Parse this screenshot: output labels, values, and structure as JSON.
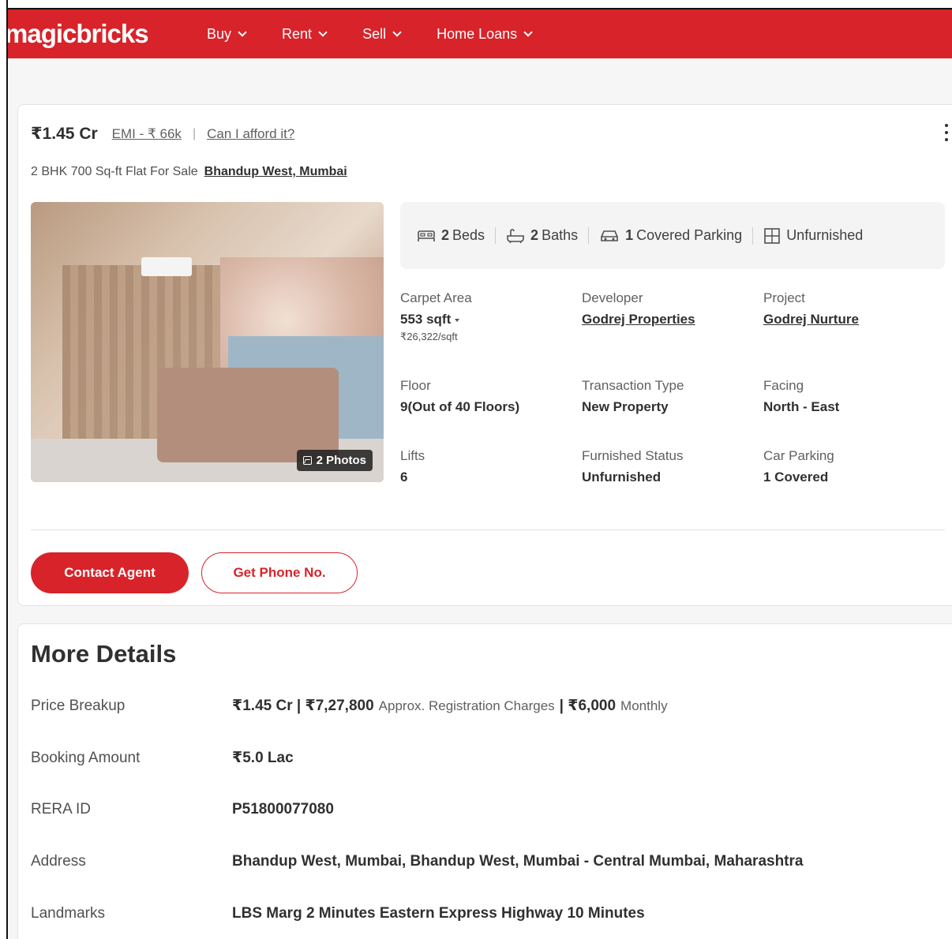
{
  "header": {
    "logo": "magicbricks",
    "nav": [
      {
        "label": "Buy"
      },
      {
        "label": "Rent"
      },
      {
        "label": "Sell"
      },
      {
        "label": "Home Loans"
      }
    ]
  },
  "listing": {
    "price": "₹1.45 Cr",
    "emi": "EMI - ₹ 66k",
    "separator": "|",
    "afford": "Can I afford it?",
    "title": "2 BHK 700 Sq-ft Flat For Sale",
    "location": "Bhandup West, Mumbai",
    "photos_label": "2 Photos",
    "amenities": [
      {
        "icon": "bed-icon",
        "value": "2",
        "label": "Beds"
      },
      {
        "icon": "bath-icon",
        "value": "2",
        "label": "Baths"
      },
      {
        "icon": "car-icon",
        "value": "1",
        "label": "Covered Parking"
      },
      {
        "icon": "furnishing-icon",
        "value": "",
        "label": "Unfurnished"
      }
    ],
    "details": {
      "carpet_area_label": "Carpet Area",
      "carpet_area_value": "553 sqft",
      "carpet_area_rate": "₹26,322/sqft",
      "developer_label": "Developer",
      "developer_value": "Godrej Properties",
      "project_label": "Project",
      "project_value": "Godrej Nurture",
      "floor_label": "Floor",
      "floor_value": "9(Out of 40 Floors)",
      "transaction_label": "Transaction Type",
      "transaction_value": "New Property",
      "facing_label": "Facing",
      "facing_value": "North - East",
      "lifts_label": "Lifts",
      "lifts_value": "6",
      "furnished_label": "Furnished Status",
      "furnished_value": "Unfurnished",
      "parking_label": "Car Parking",
      "parking_value": "1 Covered"
    },
    "contact_button": "Contact Agent",
    "phone_button": "Get Phone No."
  },
  "more_details": {
    "title": "More Details",
    "price_breakup_label": "Price Breakup",
    "price_breakup_price": "₹1.45 Cr | ₹7,27,800",
    "price_breakup_reg": "Approx. Registration Charges",
    "price_breakup_monthly_value": "| ₹6,000",
    "price_breakup_monthly": "Monthly",
    "booking_label": "Booking Amount",
    "booking_value": "₹5.0 Lac",
    "rera_label": "RERA ID",
    "rera_value": "P51800077080",
    "address_label": "Address",
    "address_value": "Bhandup West, Mumbai, Bhandup West, Mumbai - Central Mumbai, Maharashtra",
    "landmarks_label": "Landmarks",
    "landmarks_value": "LBS Marg 2 Minutes Eastern Express Highway 10 Minutes"
  },
  "colors": {
    "brand_red": "#d8232a",
    "text_dark": "#303030",
    "text_muted": "#606060"
  }
}
